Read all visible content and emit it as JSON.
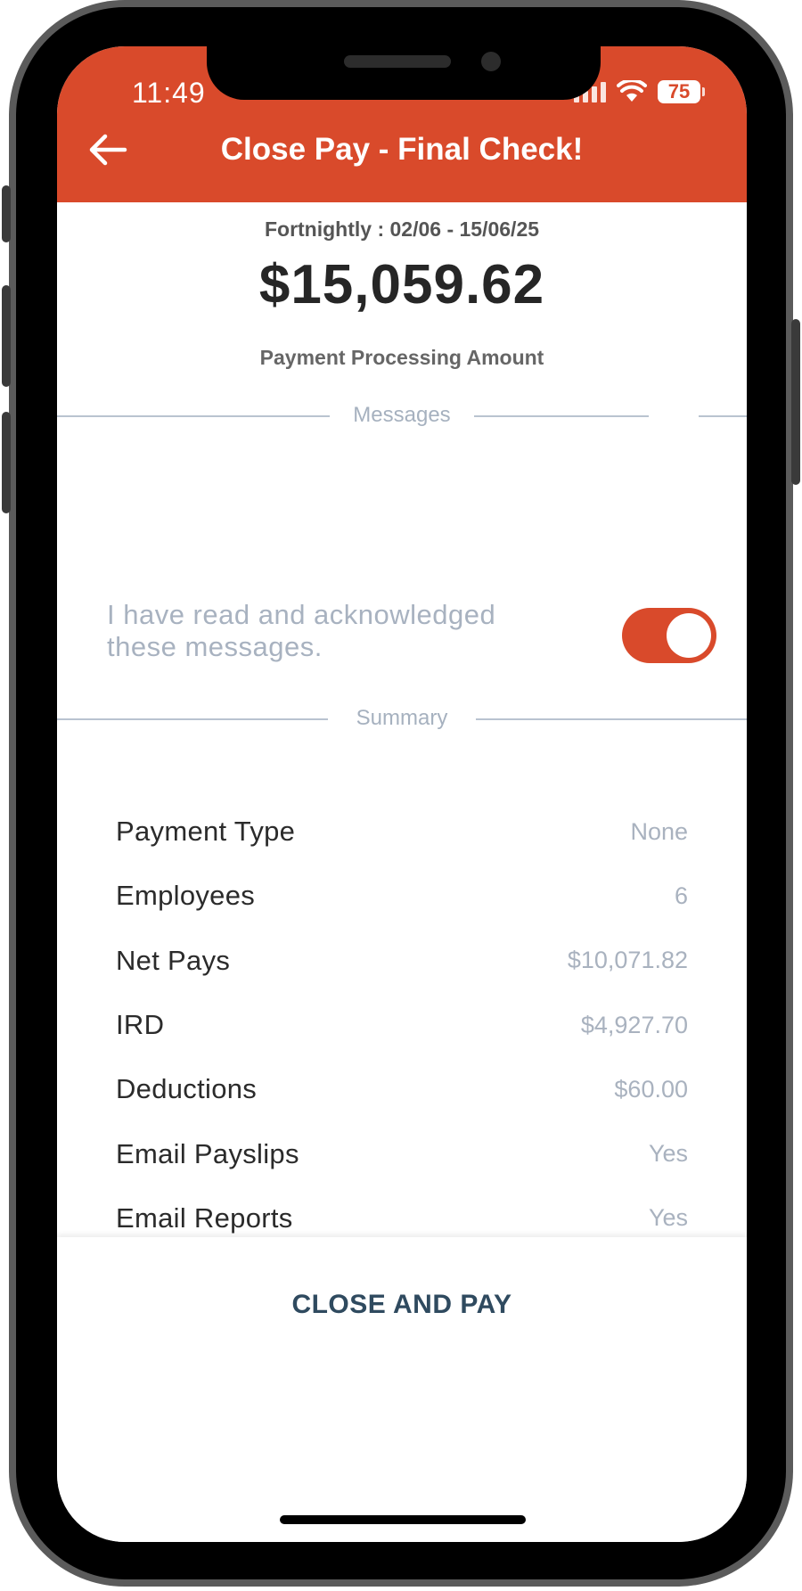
{
  "status_bar": {
    "time": "11:49",
    "battery_level": "75"
  },
  "header": {
    "title": "Close Pay - Final Check!",
    "back_icon": "arrow-left-icon"
  },
  "pay_period": {
    "period_text": "Fortnightly : 02/06 - 15/06/25",
    "amount": "$15,059.62",
    "amount_label": "Payment Processing Amount"
  },
  "messages_section": {
    "label": "Messages",
    "acknowledge_text": "I have read and acknowledged these messages.",
    "acknowledged": true
  },
  "summary_section": {
    "label": "Summary",
    "rows": [
      {
        "key": "Payment Type",
        "value": "None"
      },
      {
        "key": "Employees",
        "value": "6"
      },
      {
        "key": "Net Pays",
        "value": "$10,071.82"
      },
      {
        "key": "IRD",
        "value": "$4,927.70"
      },
      {
        "key": "Deductions",
        "value": "$60.00"
      },
      {
        "key": "Email Payslips",
        "value": "Yes"
      },
      {
        "key": "Email Reports",
        "value": "Yes"
      }
    ]
  },
  "footer": {
    "close_and_pay_label": "CLOSE AND PAY"
  },
  "colors": {
    "brand": "#d94a2b",
    "button_text": "#2f4a5f",
    "muted": "#a9b2bf"
  }
}
